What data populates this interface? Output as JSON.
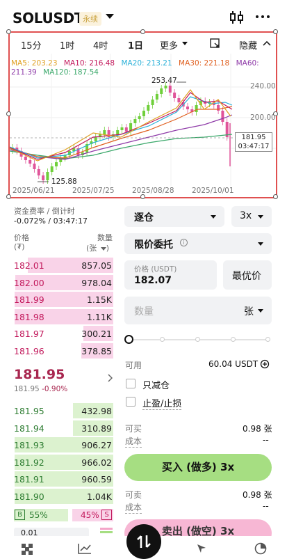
{
  "header": {
    "symbol": "SOLUSDT",
    "badge": "永续"
  },
  "chart": {
    "timeframes": [
      "15分",
      "1时",
      "4时",
      "1日",
      "更多"
    ],
    "active_timeframe": "1日",
    "hide_label": "隐藏",
    "ma_row1": [
      {
        "label": "MA5: 203.23",
        "color": "#e0a020"
      },
      {
        "label": "MA10: 216.48",
        "color": "#c2185b"
      },
      {
        "label": "MA20: 213.21",
        "color": "#2ab0d8"
      },
      {
        "label": "MA30: 221.18",
        "color": "#e06020"
      },
      {
        "label": "MA60:",
        "color": "#8e3aa8"
      }
    ],
    "ma_row2": [
      {
        "label": "211.39",
        "color": "#8e3aa8"
      },
      {
        "label": "MA120: 187.54",
        "color": "#3aa86a"
      }
    ],
    "y_ticks": [
      "240.00",
      "200.00"
    ],
    "x_ticks": [
      "2025/06/21",
      "2025/07/25",
      "2025/08/28",
      "2025/10/01"
    ],
    "high_label": "253.47",
    "low_label": "125.88",
    "current_price": "181.95",
    "countdown": "03:47:17"
  },
  "orderbook": {
    "funding_label": "资金费率 / 倒计时",
    "funding_value": "-0.072% / 03:47:17",
    "price_header": "价格",
    "price_unit": "(₮)",
    "qty_header": "数量",
    "qty_unit": "(张",
    "asks": [
      {
        "price": "182.01",
        "qty": "857.05",
        "fill": 0.85
      },
      {
        "price": "182.00",
        "qty": "978.04",
        "fill": 0.97
      },
      {
        "price": "181.99",
        "qty": "1.15K",
        "fill": 0.98
      },
      {
        "price": "181.98",
        "qty": "1.11K",
        "fill": 0.98
      },
      {
        "price": "181.97",
        "qty": "300.21",
        "fill": 0.3
      },
      {
        "price": "181.96",
        "qty": "378.85",
        "fill": 0.32
      }
    ],
    "last_price": "181.95",
    "last_sub_price": "181.95",
    "last_change": "-0.90%",
    "bids": [
      {
        "price": "181.95",
        "qty": "432.98",
        "fill": 0.4
      },
      {
        "price": "181.94",
        "qty": "310.89",
        "fill": 0.4
      },
      {
        "price": "181.93",
        "qty": "906.27",
        "fill": 0.98
      },
      {
        "price": "181.92",
        "qty": "966.02",
        "fill": 0.98
      },
      {
        "price": "181.91",
        "qty": "960.59",
        "fill": 0.98
      },
      {
        "price": "181.90",
        "qty": "1.04K",
        "fill": 0.98
      }
    ],
    "buy_ratio_tag": "B",
    "buy_ratio": "55%",
    "sell_ratio": "45%",
    "sell_ratio_tag": "S",
    "depth_value": "0.01"
  },
  "form": {
    "margin_mode": "逐仓",
    "leverage": "3x",
    "order_type": "限价委托",
    "price_label": "价格 (USDT)",
    "price_value": "182.07",
    "best_price_label": "最优价",
    "qty_placeholder": "数量",
    "qty_unit": "张",
    "available_label": "可用",
    "available_value": "60.04 USDT",
    "reduce_only_label": "只减仓",
    "tpsl_label": "止盈/止损",
    "can_buy_label": "可买",
    "can_buy_value": "0.98 张",
    "cost_label": "成本",
    "cost_value": "--",
    "buy_button": "买入 (做多) 3x",
    "can_sell_label": "可卖",
    "can_sell_value": "0.98 张",
    "cost2_label": "成本",
    "cost2_value": "--",
    "sell_button": "卖出 (做空) 3x"
  }
}
